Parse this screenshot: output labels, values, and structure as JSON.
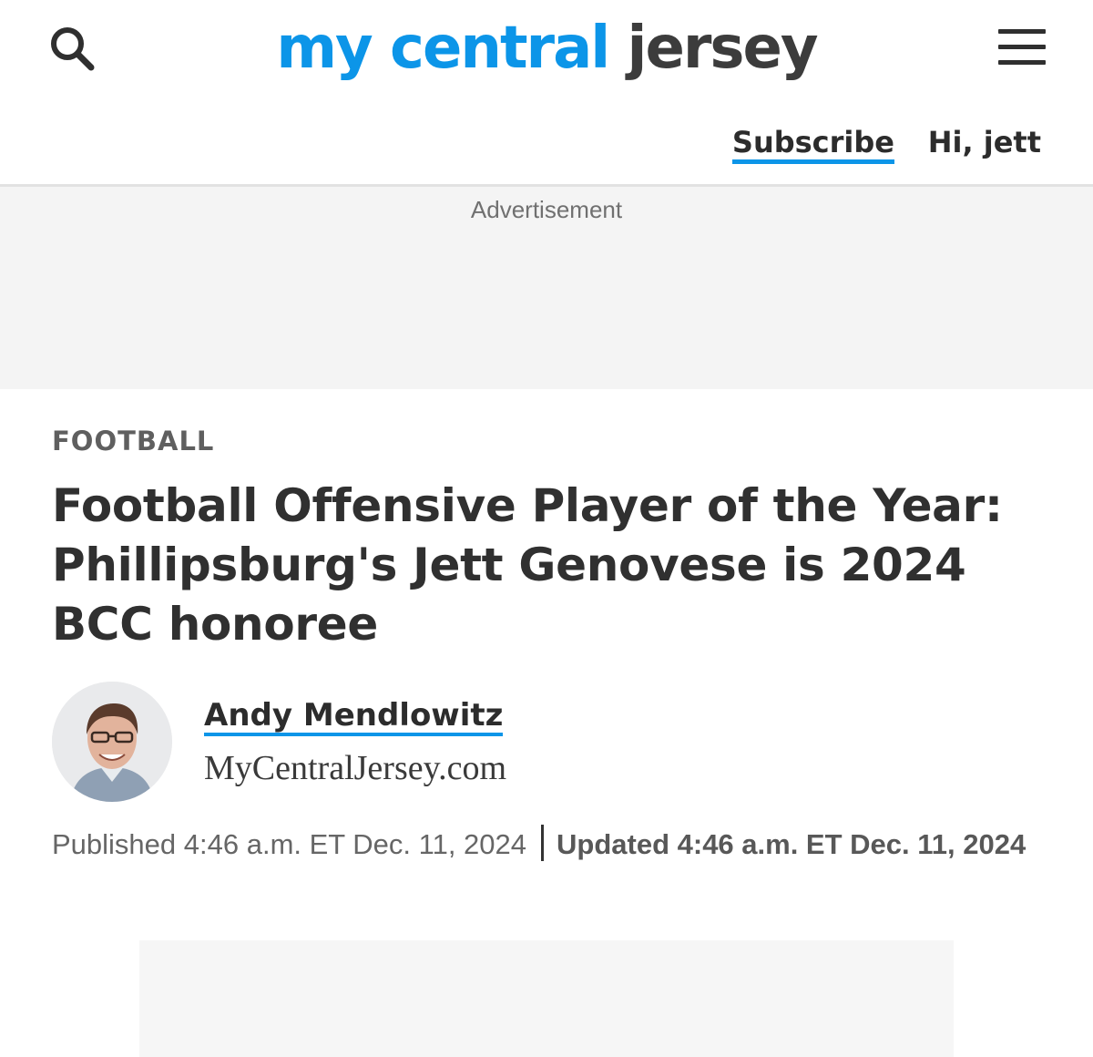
{
  "header": {
    "logo_part1": "my central",
    "logo_part2": "jersey",
    "subscribe_label": "Subscribe",
    "greeting": "Hi, jett"
  },
  "ad": {
    "label": "Advertisement"
  },
  "article": {
    "section": "FOOTBALL",
    "headline": "Football Offensive Player of the Year: Phillipsburg's Jett Genovese is 2024 BCC honoree",
    "author": {
      "name": "Andy Mendlowitz",
      "outlet": "MyCentralJersey.com"
    },
    "published": "Published 4:46 a.m. ET Dec. 11, 2024",
    "updated": "Updated 4:46 a.m. ET Dec. 11, 2024"
  },
  "colors": {
    "brand_blue": "#0c95e8",
    "text_dark": "#303030"
  },
  "icons": {
    "search": "search-icon",
    "menu": "hamburger-menu-icon"
  }
}
